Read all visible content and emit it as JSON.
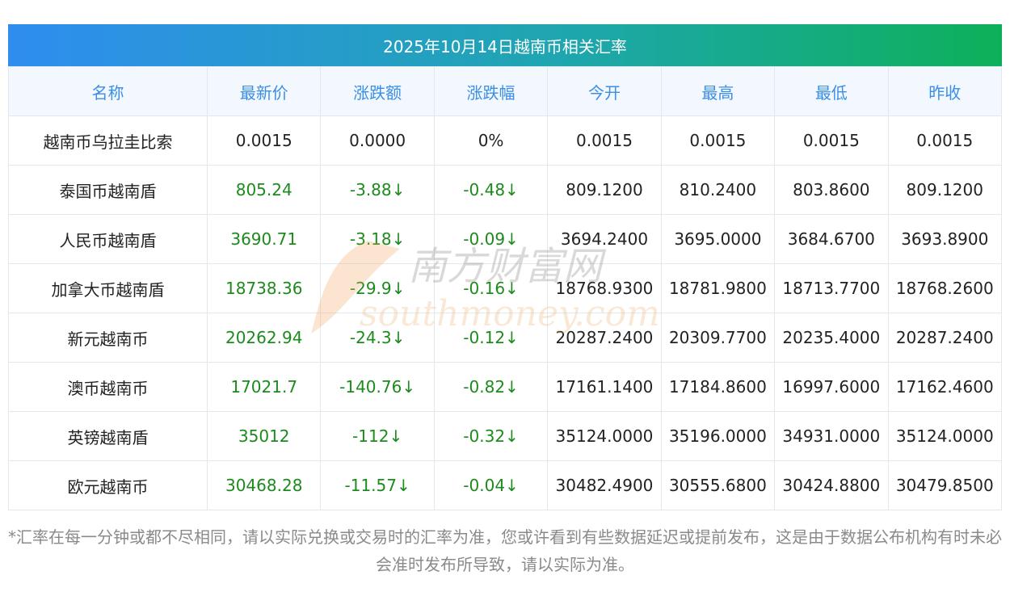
{
  "title": "2025年10月14日越南币相关汇率",
  "headers": [
    "名称",
    "最新价",
    "涨跌额",
    "涨跌幅",
    "今开",
    "最高",
    "最低",
    "昨收"
  ],
  "rows": [
    {
      "name": "越南币乌拉圭比索",
      "latest": "0.0015",
      "change": "0.0000",
      "pct": "0%",
      "open": "0.0015",
      "high": "0.0015",
      "low": "0.0015",
      "prev": "0.0015"
    },
    {
      "name": "泰国币越南盾",
      "latest": "805.24",
      "change": "-3.88↓",
      "pct": "-0.48↓",
      "open": "809.1200",
      "high": "810.2400",
      "low": "803.8600",
      "prev": "809.1200"
    },
    {
      "name": "人民币越南盾",
      "latest": "3690.71",
      "change": "-3.18↓",
      "pct": "-0.09↓",
      "open": "3694.2400",
      "high": "3695.0000",
      "low": "3684.6700",
      "prev": "3693.8900"
    },
    {
      "name": "加拿大币越南盾",
      "latest": "18738.36",
      "change": "-29.9↓",
      "pct": "-0.16↓",
      "open": "18768.9300",
      "high": "18781.9800",
      "low": "18713.7700",
      "prev": "18768.2600"
    },
    {
      "name": "新元越南币",
      "latest": "20262.94",
      "change": "-24.3↓",
      "pct": "-0.12↓",
      "open": "20287.2400",
      "high": "20309.7700",
      "low": "20235.4000",
      "prev": "20287.2400"
    },
    {
      "name": "澳币越南币",
      "latest": "17021.7",
      "change": "-140.76↓",
      "pct": "-0.82↓",
      "open": "17161.1400",
      "high": "17184.8600",
      "low": "16997.6000",
      "prev": "17162.4600"
    },
    {
      "name": "英镑越南盾",
      "latest": "35012",
      "change": "-112↓",
      "pct": "-0.32↓",
      "open": "35124.0000",
      "high": "35196.0000",
      "low": "34931.0000",
      "prev": "35124.0000"
    },
    {
      "name": "欧元越南币",
      "latest": "30468.28",
      "change": "-11.57↓",
      "pct": "-0.04↓",
      "open": "30482.4900",
      "high": "30555.6800",
      "low": "30424.8800",
      "prev": "30479.8500"
    }
  ],
  "note": "*汇率在每一分钟或都不尽相同，请以实际兑换或交易时的汇率为准，您或许看到有些数据延迟或提前发布，这是由于数据公布机构有时未必会准时发布所导致，请以实际为准。",
  "watermark": {
    "cn": "南方财富网",
    "en": "southmoney.com"
  },
  "colors": {
    "header_text": "#3a8ee6",
    "value_green": "#1d8a1d",
    "gradient_start": "#2f8df0",
    "gradient_end": "#0db05a"
  }
}
